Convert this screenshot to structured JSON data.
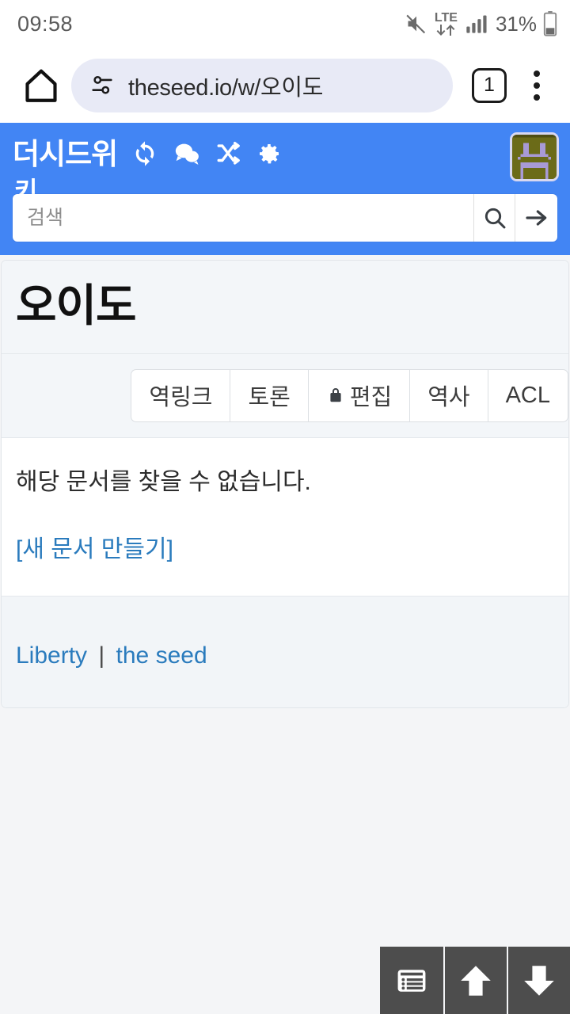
{
  "status_bar": {
    "time": "09:58",
    "network_type": "LTE",
    "battery_percent": "31%",
    "icons": [
      "mute-icon",
      "lte-data-icon",
      "signal-bars-icon",
      "battery-icon"
    ]
  },
  "browser": {
    "home_icon": "home-icon",
    "site_info_icon": "page-info-icon",
    "url": "theseed.io/w/오이도",
    "tab_count": "1",
    "menu_icon": "kebab-menu-icon"
  },
  "wiki_header": {
    "site_title": "더시드위",
    "site_title_overflow": "키",
    "icons": [
      "refresh-icon",
      "discussion-icon",
      "shuffle-icon",
      "settings-icon"
    ],
    "avatar_alt": "user-avatar",
    "search": {
      "placeholder": "검색",
      "value": "",
      "search_icon": "search-icon",
      "go_icon": "arrow-right-icon"
    },
    "accent_color": "#4285f4"
  },
  "document": {
    "title": "오이도",
    "tabs": [
      {
        "label": "역링크",
        "icon": ""
      },
      {
        "label": "토론",
        "icon": ""
      },
      {
        "label": "편집",
        "icon": "lock-icon"
      },
      {
        "label": "역사",
        "icon": ""
      },
      {
        "label": "ACL",
        "icon": ""
      }
    ],
    "not_found_text": "해당 문서를 찾을 수 없습니다.",
    "create_link": "[새 문서 만들기]",
    "link_color": "#2a7bbd"
  },
  "footer": {
    "links": [
      "Liberty",
      "the seed"
    ],
    "separator": "|"
  },
  "float_toolbar": {
    "buttons": [
      "toc-icon",
      "scroll-up-icon",
      "scroll-down-icon"
    ]
  }
}
